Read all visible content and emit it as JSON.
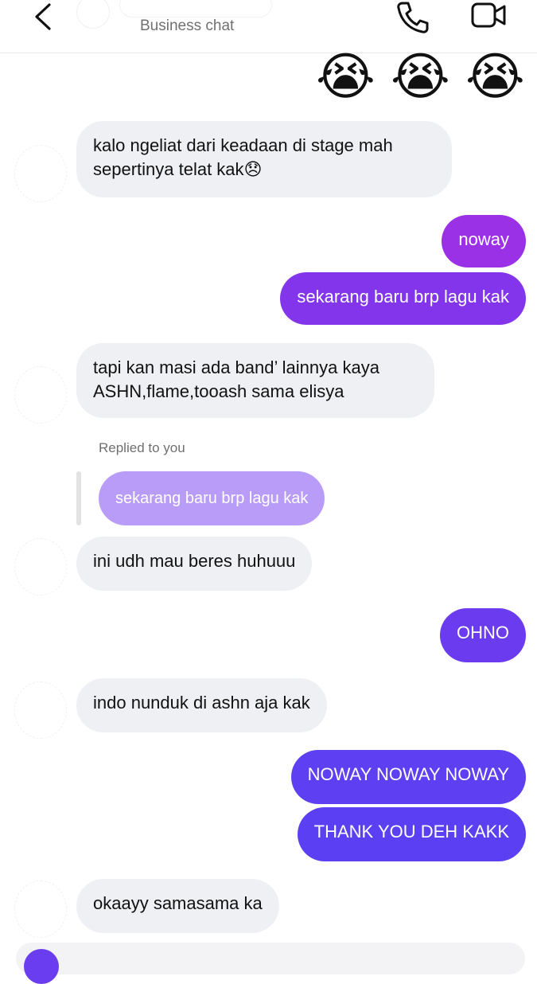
{
  "header": {
    "subtitle": "Business chat",
    "icons": [
      "back-chevron-icon",
      "phone-icon",
      "video-camera-icon"
    ]
  },
  "reactions": [
    "😭",
    "😭",
    "😭"
  ],
  "messages": [
    {
      "side": "in",
      "text": "kalo ngeliat dari keadaan di stage mah\nsepertinya telat kak😞"
    },
    {
      "side": "out",
      "text": "noway"
    },
    {
      "side": "out",
      "text": "sekarang baru brp lagu kak"
    },
    {
      "side": "in",
      "text": "tapi kan masi ada band’ lainnya kaya\nASHN,flame,tooash sama elisya"
    },
    {
      "side": "in",
      "reply_label": "Replied to you",
      "reply_quote": "sekarang baru brp lagu kak",
      "text": "ini udh mau beres huhuuu"
    },
    {
      "side": "out",
      "text": "OHNO"
    },
    {
      "side": "in",
      "text": "indo nunduk di ashn aja kak"
    },
    {
      "side": "out",
      "text": "NOWAY NOWAY NOWAY"
    },
    {
      "side": "out",
      "text": "THANK YOU DEH KAKK"
    },
    {
      "side": "in",
      "text": "okaayy samasama ka"
    }
  ],
  "colors": {
    "incoming_bubble": "#eff0f3",
    "outgoing_gradient": [
      "#9b31e6",
      "#8235ea",
      "#6b3bf0",
      "#5f3ff2",
      "#5b40f3"
    ],
    "reply_quote": "#b99cf7"
  }
}
